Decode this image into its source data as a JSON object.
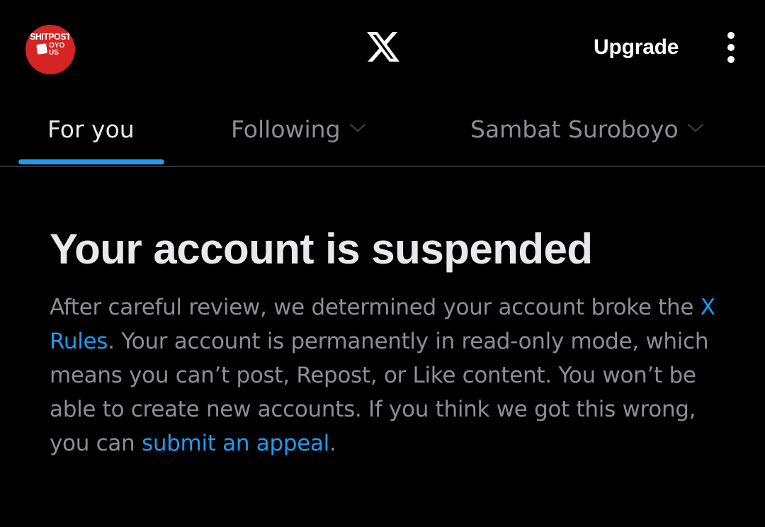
{
  "header": {
    "avatar": {
      "line1": "SHITPOST",
      "line2": "OYO",
      "line3": "US",
      "color": "#d42424"
    },
    "logo_icon": "x-logo-icon",
    "upgrade_label": "Upgrade",
    "menu_icon": "more-vertical-icon"
  },
  "tabs": [
    {
      "label": "For you",
      "active": true
    },
    {
      "label": "Following",
      "active": false,
      "icon": "chevron-down-icon"
    },
    {
      "label": "Sambat Suroboyo",
      "active": false,
      "icon": "chevron-down-icon"
    }
  ],
  "notice": {
    "title": "Your account is suspended",
    "body_part1": "After careful review, we determined your account broke the ",
    "rules_link": "X Rules",
    "body_part2": ". Your account is permanently in read-only mode, which means you can’t post, Repost, or Like content. You won’t be able to create new accounts. If you think we got this wrong, you can ",
    "appeal_link": "submit an appeal",
    "body_part3": "."
  },
  "colors": {
    "background": "#000000",
    "text_primary": "#e7e9ea",
    "text_secondary": "#8b8f94",
    "accent": "#1d9bf0",
    "divider": "#2f3336"
  }
}
